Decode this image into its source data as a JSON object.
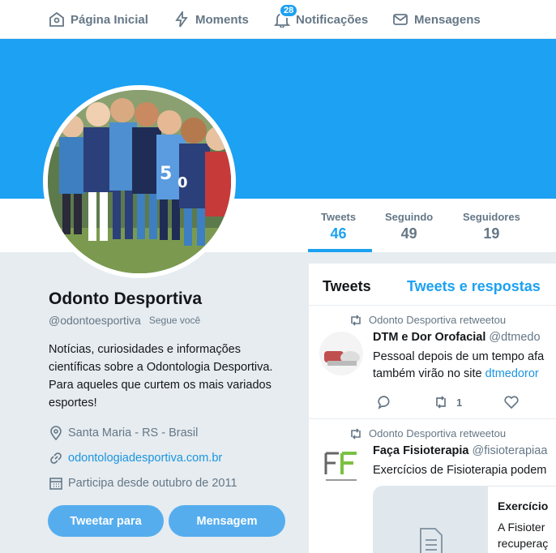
{
  "nav": {
    "home": "Página Inicial",
    "moments": "Moments",
    "notifications": "Notificações",
    "notifications_count": "28",
    "messages": "Mensagens"
  },
  "colors": {
    "accent": "#1da1f2",
    "button": "#55adee",
    "link": "#1b95e0"
  },
  "stats": [
    {
      "label": "Tweets",
      "value": "46"
    },
    {
      "label": "Seguindo",
      "value": "49"
    },
    {
      "label": "Seguidores",
      "value": "19"
    }
  ],
  "profile": {
    "name": "Odonto Desportiva",
    "handle": "@odontoesportiva",
    "follows_you": "Segue você",
    "bio": "Notícias, curiosidades e informações científicas sobre a Odontologia Desportiva. Para aqueles que curtem os mais variados esportes!",
    "location": "Santa Maria - RS - Brasil",
    "url": "odontologiadesportiva.com.br",
    "joined": "Participa desde outubro de 2011",
    "tweet_to_button": "Tweetar para",
    "message_button": "Mensagem"
  },
  "timeline": {
    "tabs": [
      "Tweets",
      "Tweets e respostas"
    ],
    "tweets": [
      {
        "retweet_note": "Odonto Desportiva retweetou",
        "author": "DTM e Dor Orofacial",
        "handle": "@dtmedo",
        "line1": "Pessoal depois de um tempo afa",
        "line2_prefix": "também virão no site ",
        "line2_link": "dtmedoror",
        "retweets": "1"
      },
      {
        "retweet_note": "Odonto Desportiva retweetou",
        "author": "Faça Fisioterapia",
        "handle": "@fisioterapiaa",
        "text": "Exercícios de Fisioterapia podem",
        "card_title": "Exercício",
        "card_line1": "A Fisioter",
        "card_line2": "recuperaç"
      }
    ]
  }
}
